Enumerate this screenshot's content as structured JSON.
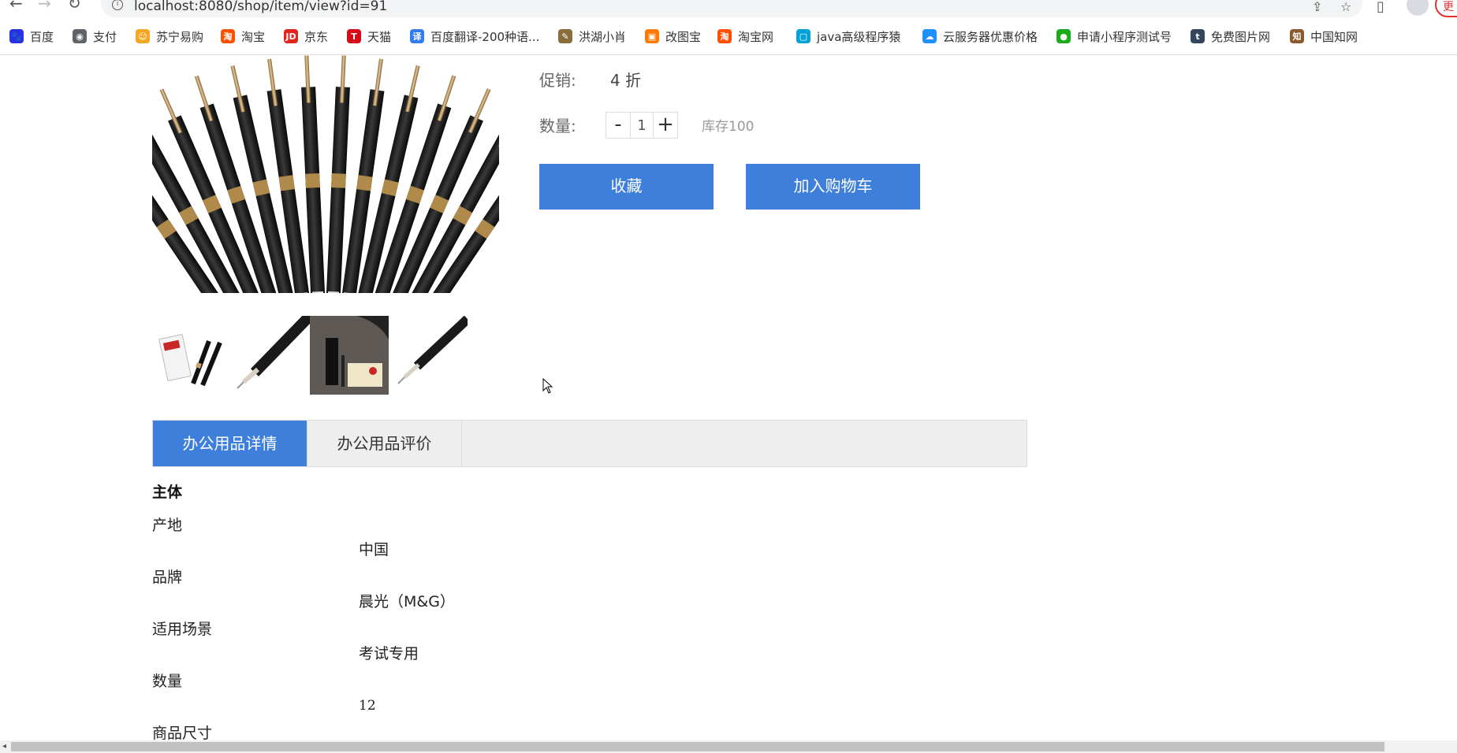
{
  "browser": {
    "url": "localhost:8080/shop/item/view?id=91",
    "update_label": "更"
  },
  "bookmarks": [
    {
      "label": "百度",
      "icon": "baidu-icon",
      "color": "#2932e1"
    },
    {
      "label": "支付",
      "icon": "globe-icon",
      "color": "#5f6368"
    },
    {
      "label": "苏宁易购",
      "icon": "suning-icon",
      "color": "#f5a623"
    },
    {
      "label": "淘宝",
      "icon": "taobao-icon",
      "color": "#ff5000"
    },
    {
      "label": "京东",
      "icon": "jd-icon",
      "color": "#e1251b"
    },
    {
      "label": "天猫",
      "icon": "tmall-icon",
      "color": "#d70b17"
    },
    {
      "label": "百度翻译-200种语...",
      "icon": "baidu-translate-icon",
      "color": "#2e7cf6"
    },
    {
      "label": "洪湖小肖",
      "icon": "bird-icon",
      "color": "#8a6d3b"
    },
    {
      "label": "改图宝",
      "icon": "gaitubao-icon",
      "color": "#ff7a00"
    },
    {
      "label": "淘宝网",
      "icon": "taobao-net-icon",
      "color": "#ff5000"
    },
    {
      "label": "java高级程序猿",
      "icon": "bilibili-icon",
      "color": "#00a1d6"
    },
    {
      "label": "云服务器优惠价格",
      "icon": "cloud-icon",
      "color": "#1e90ff"
    },
    {
      "label": "申请小程序测试号",
      "icon": "wechat-icon",
      "color": "#1aad19"
    },
    {
      "label": "免费图片网",
      "icon": "t-icon",
      "color": "#35465c"
    },
    {
      "label": "中国知网",
      "icon": "cnki-icon",
      "color": "#8b5a2b"
    }
  ],
  "product": {
    "promo_label": "促销:",
    "promo_value": "4 折",
    "qty_label": "数量:",
    "qty_minus": "-",
    "qty_value": "1",
    "qty_plus": "+",
    "stock": "库存100",
    "favorite_button": "收藏",
    "cart_button": "加入购物车"
  },
  "tabs": [
    {
      "label": "办公用品详情",
      "active": true
    },
    {
      "label": "办公用品评价",
      "active": false
    }
  ],
  "details": {
    "section_title": "主体",
    "specs": [
      {
        "name": "产地",
        "value": "中国"
      },
      {
        "name": "品牌",
        "value": "晨光（M&G）"
      },
      {
        "name": "适用场景",
        "value": "考试专用"
      },
      {
        "name": "数量",
        "value": "12"
      },
      {
        "name": "商品尺寸",
        "value": ""
      }
    ]
  },
  "colors": {
    "accent": "#3f7fdc"
  }
}
